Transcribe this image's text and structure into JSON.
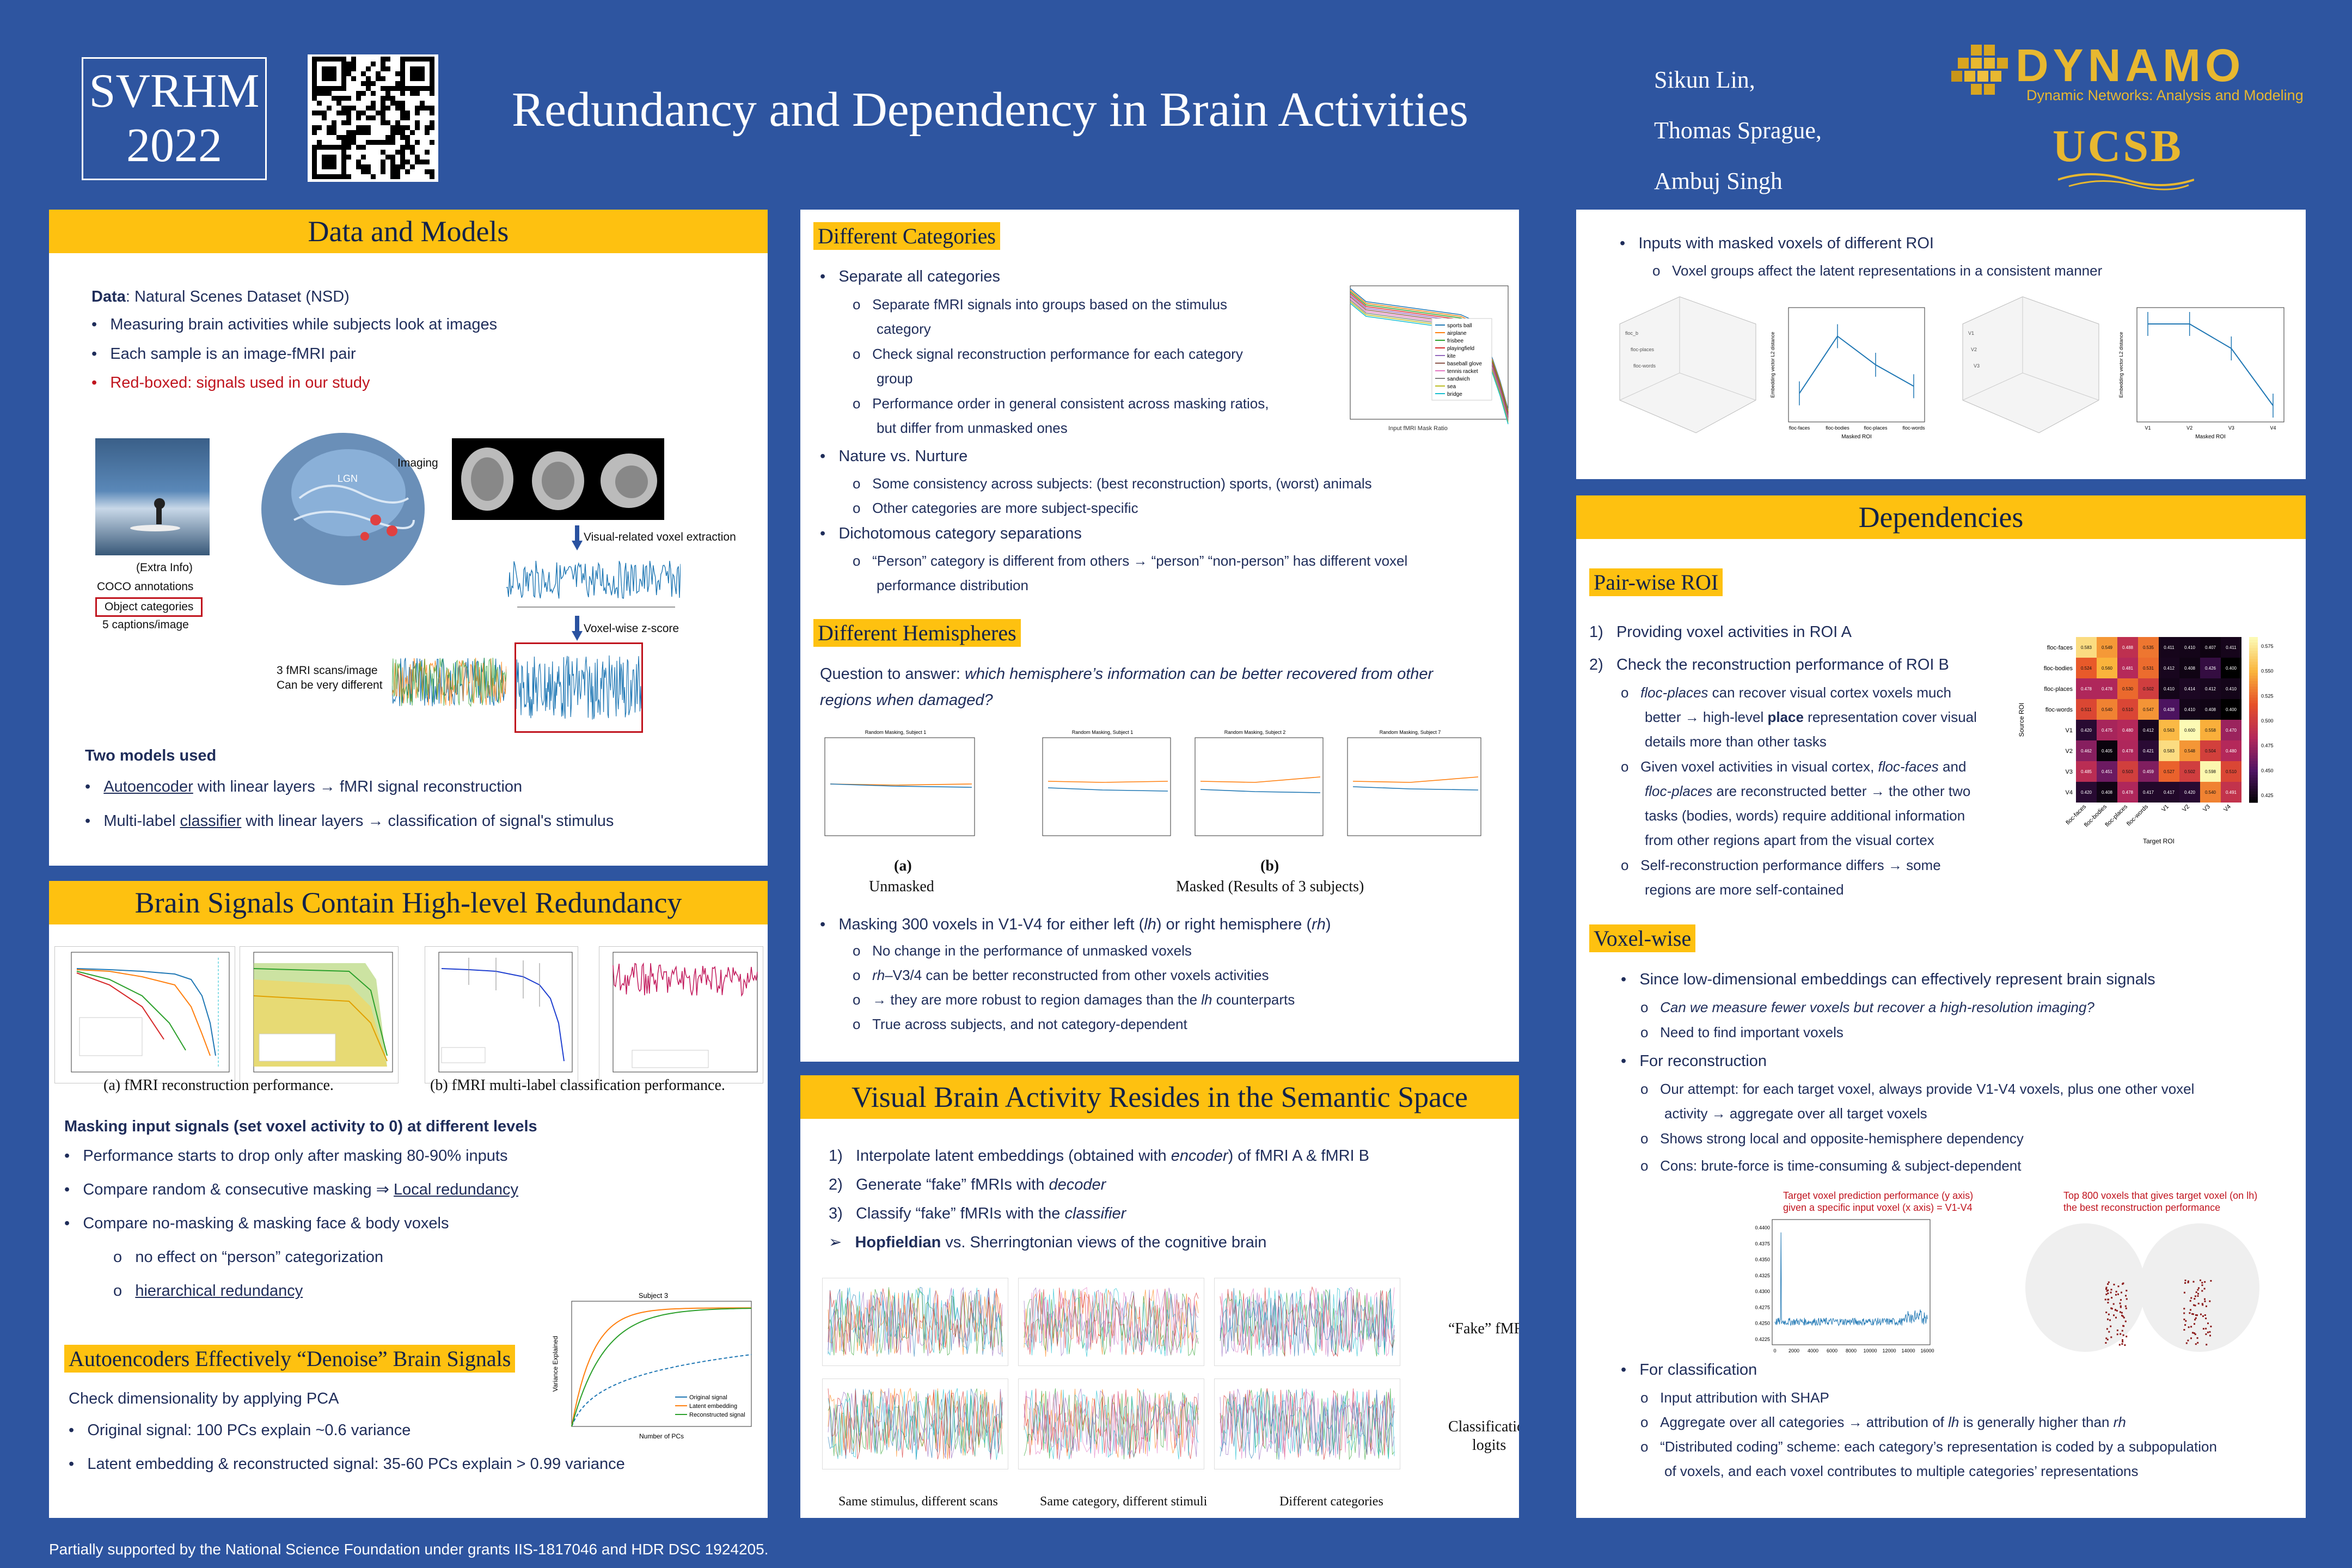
{
  "header": {
    "badge_line1": "SVRHM",
    "badge_line2": "2022",
    "title": "Redundancy and Dependency in Brain Activities",
    "authors": [
      "Sikun Lin,",
      "Thomas Sprague,",
      "Ambuj Singh"
    ],
    "logo_name": "DYNAMO",
    "logo_sub": "Dynamic Networks: Analysis and Modeling",
    "ucsb": "UCSB"
  },
  "data_models": {
    "heading": "Data and Models",
    "data_label": "Data",
    "data_text": ": Natural Scenes Dataset (NSD)",
    "bullets": [
      "Measuring brain activities while subjects look at images",
      "Each sample is an image-fMRI pair",
      "Red-boxed: signals used in our study"
    ],
    "fig_labels": {
      "imaging": "Imaging",
      "extraction": "Visual-related voxel extraction",
      "zscore": "Voxel-wise z-score",
      "extra1": "(Extra Info)",
      "extra2": "COCO annotations",
      "extra3": "Object categories",
      "extra4": "5 captions/image",
      "scans1": "3 fMRI scans/image",
      "scans2": "Can be very different"
    },
    "models_heading": "Two models used",
    "model1_link": "Autoencoder",
    "model1_rest": " with linear layers → fMRI signal reconstruction",
    "model2_pre": "Multi-label ",
    "model2_link": "classifier",
    "model2_rest": " with linear layers → classification of signal's stimulus"
  },
  "redundancy": {
    "heading": "Brain Signals Contain High-level Redundancy",
    "cap_a": "(a) fMRI reconstruction performance.",
    "cap_b": "(b) fMRI multi-label classification performance.",
    "masking_heading": "Masking input signals (set voxel activity to 0) at different levels",
    "b1": "Performance starts to drop only after masking 80-90% inputs",
    "b2_pre": "Compare random & consecutive masking ⇒ ",
    "b2_link": "Local redundancy",
    "b3": "Compare no-masking & masking face & body voxels",
    "s1": "no effect on “person” categorization",
    "s2": "hierarchical redundancy",
    "denoise_heading": "Autoencoders Effectively “Denoise” Brain Signals",
    "d0": "Check dimensionality by applying PCA",
    "d1": "Original signal: 100 PCs explain ~0.6 variance",
    "d2": "Latent embedding & reconstructed signal: 35-60 PCs explain > 0.99 variance",
    "pca_chart_title": "Subject 3",
    "pca_legend": [
      "Original signal",
      "Latent embedding",
      "Reconstructed signal"
    ],
    "pca_xlabel": "Number of PCs",
    "pca_ylabel": "Variance Explained"
  },
  "categories": {
    "heading": "Different Categories",
    "b1": "Separate all categories",
    "s1a": "Separate fMRI signals into groups based on the stimulus",
    "s1b": "category",
    "s2a": "Check signal reconstruction performance for each category",
    "s2b": "group",
    "s3a": "Performance order in general consistent across masking ratios,",
    "s3b": "but differ from unmasked ones",
    "b2": "Nature vs. Nurture",
    "s4": "Some consistency across subjects: (best reconstruction) sports, (worst) animals",
    "s5": "Other categories are more subject-specific",
    "b3": "Dichotomous category separations",
    "s6a": "“Person” category is different from others → “person” “non-person” has different voxel",
    "s6b": "performance distribution",
    "legend": [
      "sports ball",
      "airplane",
      "frisbee",
      "playingfield",
      "kite",
      "baseball glove",
      "tennis racket",
      "sandwich",
      "sea",
      "bridge"
    ],
    "xlabel": "Input fMRI Mask Ratio"
  },
  "hemispheres": {
    "heading": "Different Hemispheres",
    "q_pre": "Question to answer: ",
    "q_it1": "which hemisphere’s information can be better recovered from other",
    "q_it2": "regions when damaged?",
    "panel_titles": [
      "Random Masking, Subject 1",
      "Random Masking, Subject 1",
      "Random Masking, Subject 2",
      "Random Masking, Subject 7"
    ],
    "cap_a1": "(a)",
    "cap_a2": "Unmasked",
    "cap_b1": "(b)",
    "cap_b2": "Masked (Results of 3 subjects)",
    "b1_pre": "Masking 300 voxels in V1-V4 for either left (",
    "b1_lh": "lh",
    "b1_mid": ") or right hemisphere (",
    "b1_rh": "rh",
    "b1_end": ")",
    "s1": "No change in the performance of unmasked voxels",
    "s2_it": "rh",
    "s2": "–V3/4 can be better reconstructed from other voxels activities",
    "s3_pre": "→ they are more robust to region damages than the ",
    "s3_it": "lh",
    "s3_end": " counterparts",
    "s4": "True across subjects, and not category-dependent"
  },
  "semantic": {
    "heading": "Visual Brain Activity Resides in the Semantic Space",
    "i1_pre": "Interpolate latent embeddings (obtained with ",
    "i1_it": "encoder",
    "i1_end": ") of fMRI A & fMRI B",
    "i2_pre": "Generate “fake” fMRIs with ",
    "i2_it": "decoder",
    "i3_pre": "Classify “fake” fMRIs with the ",
    "i3_it": "classifier",
    "i4_bold": "Hopfieldian",
    "i4_rest": " vs. Sherringtonian views of the cognitive brain",
    "fake_label": "“Fake” fMRIs",
    "logits_1": "Classification",
    "logits_2": "logits",
    "cap1": "Same stimulus, different scans",
    "cap2": "Same category, different stimuli",
    "cap3": "Different categories"
  },
  "roi": {
    "b1": "Inputs with masked voxels of different ROI",
    "s1": "Voxel groups affect the latent representations in a consistent manner",
    "xlabel": "Masked ROI",
    "ylabel": "Embedding vector L2 distance",
    "cats_a": [
      "floc-faces",
      "floc-bodies",
      "floc-places",
      "floc-words"
    ],
    "cats_b": [
      "V1",
      "V2",
      "V3",
      "V4"
    ],
    "values_a": [
      24,
      32,
      28,
      25
    ],
    "values_b": [
      30,
      30,
      27,
      20
    ],
    "ylim_a": [
      20,
      36
    ],
    "ylim_b": [
      18,
      32
    ]
  },
  "dependencies": {
    "heading": "Dependencies",
    "pairwise_heading": "Pair-wise ROI",
    "p1": "Providing voxel activities in ROI A",
    "p2": "Check the reconstruction performance of ROI B",
    "p2s1_it": "floc-places",
    "p2s1a": " can recover visual cortex voxels much",
    "p2s1b_pre": "better → high-level ",
    "p2s1b_bold": "place",
    "p2s1b_rest": " representation cover visual",
    "p2s1c": "details more than other tasks",
    "p2s2a_pre": "Given voxel activities in visual cortex, ",
    "p2s2a_it": "floc-faces",
    "p2s2a_end": " and",
    "p2s2b_it": "floc-places",
    "p2s2b_rest": " are reconstructed better →  the other two",
    "p2s2c": "tasks (bodies, words) require additional information",
    "p2s2d": "from other regions apart from the visual cortex",
    "p2s3a": "Self-reconstruction performance differs → some",
    "p2s3b": "regions are more self-contained",
    "heatmap_labels": [
      "floc-faces",
      "floc-bodies",
      "floc-places",
      "floc-words",
      "V1",
      "V2",
      "V3",
      "V4"
    ],
    "heatmap_values": [
      [
        0.583,
        0.549,
        0.488,
        0.535,
        0.411,
        0.41,
        0.407,
        0.411
      ],
      [
        0.524,
        0.56,
        0.481,
        0.531,
        0.412,
        0.408,
        0.426,
        0.4
      ],
      [
        0.478,
        0.478,
        0.53,
        0.502,
        0.41,
        0.414,
        0.412,
        0.41
      ],
      [
        0.511,
        0.54,
        0.51,
        0.547,
        0.438,
        0.41,
        0.408,
        0.4
      ],
      [
        0.42,
        0.475,
        0.48,
        0.412,
        0.563,
        0.6,
        0.558,
        0.47
      ],
      [
        0.462,
        0.405,
        0.478,
        0.421,
        0.583,
        0.548,
        0.504,
        0.48
      ],
      [
        0.485,
        0.451,
        0.503,
        0.459,
        0.527,
        0.502,
        0.598,
        0.51
      ],
      [
        0.42,
        0.408,
        0.478,
        0.417,
        0.417,
        0.42,
        0.54,
        0.491
      ]
    ],
    "heatmap_ylabel": "Source ROI",
    "heatmap_xlabel": "Target ROI",
    "colorbar_ticks": [
      "0.575",
      "0.550",
      "0.525",
      "0.500",
      "0.475",
      "0.450",
      "0.425"
    ],
    "voxelwise_heading": "Voxel-wise",
    "v1": "Since low-dimensional embeddings can effectively represent brain signals",
    "v1s1": "Can we measure fewer voxels but recover a high-resolution imaging?",
    "v1s2": "Need to find important voxels",
    "v2": "For reconstruction",
    "v2s1a": "Our attempt: for each target voxel, always provide V1-V4 voxels, plus one other voxel",
    "v2s1b": "activity → aggregate over all target voxels",
    "v2s2": "Shows strong local and opposite-hemisphere dependency",
    "v2s3": "Cons: brute-force is time-consuming & subject-dependent",
    "plot_title1": "Target voxel prediction performance (y axis)",
    "plot_title2": "given a specific input voxel (x axis) = V1-V4",
    "plot_yticks": [
      "0.4400",
      "0.4375",
      "0.4350",
      "0.4325",
      "0.4300",
      "0.4275",
      "0.4250",
      "0.4225"
    ],
    "plot_xticks": [
      "0",
      "2000",
      "4000",
      "6000",
      "8000",
      "10000",
      "12000",
      "14000",
      "16000"
    ],
    "map_title1": "Top 800 voxels that gives target voxel (on lh)",
    "map_title2": "the best reconstruction performance",
    "v3": "For classification",
    "v3s1": "Input attribution with SHAP",
    "v3s2_pre": "Aggregate over all categories → attribution of ",
    "v3s2_it1": "lh",
    "v3s2_mid": " is generally higher than ",
    "v3s2_it2": "rh",
    "v3s3a": "“Distributed coding” scheme: each category’s representation is coded by a subpopulation",
    "v3s3b": "of voxels, and each voxel contributes to multiple categories’ representations"
  },
  "footer": "Partially supported by the National Science Foundation under grants IIS-1817046 and HDR DSC 1924205.",
  "colors": {
    "background": "#2e55a0",
    "accent": "#fec110",
    "text": "#1f2d5a",
    "red": "#c0141e",
    "blue_signal": "#1f77b4"
  },
  "icons": [
    "qr-code-icon",
    "dynamo-logo-icon",
    "ucsb-logo-icon",
    "brain-icon"
  ]
}
